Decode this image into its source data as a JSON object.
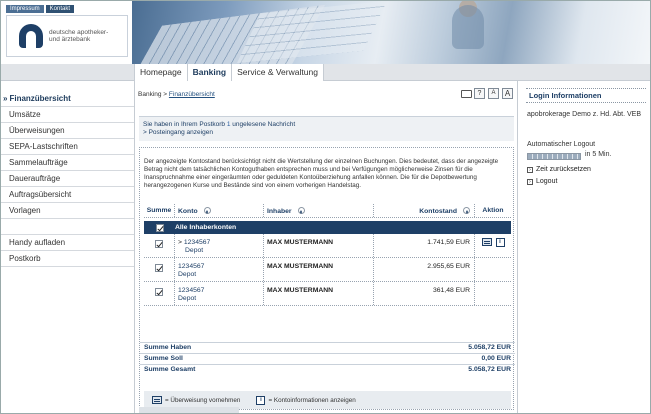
{
  "header": {
    "links": [
      "Impressum",
      "Kontakt"
    ],
    "logo_line1": "deutsche apotheker-",
    "logo_line2": "und ärztebank"
  },
  "mainnav": [
    "Homepage",
    "Banking",
    "Service & Verwaltung"
  ],
  "sidebar": {
    "items": [
      "Finanzübersicht",
      "Umsätze",
      "Überweisungen",
      "SEPA-Lastschriften",
      "Sammelaufträge",
      "Daueraufträge",
      "Auftragsübersicht",
      "Vorlagen"
    ],
    "items2": [
      "Handy aufladen",
      "Postkorb"
    ]
  },
  "breadcrumb": {
    "prefix": "Banking > ",
    "current": "Finanzübersicht"
  },
  "toolbar_icons": [
    "printer-icon",
    "help-icon",
    "font-small-icon",
    "font-large-icon"
  ],
  "toolbar_text": {
    "help": "?",
    "small": "A",
    "large": "A"
  },
  "message": {
    "prefix": "Sie haben in Ihrem Postkorb ",
    "count": "1",
    "suffix": " ungelesene Nachricht",
    "link": "> Posteingang anzeigen"
  },
  "info_text": "Der angezeigte Kontostand berücksichtigt nicht die Wertstellung der einzelnen Buchungen. Dies bedeutet, dass der angezeigte Betrag nicht dem tatsächlichen Kontoguthaben entsprechen muss und bei Verfügungen möglicherweise Zinsen für die Inanspruchnahme einer eingeräumten oder geduldeten Kontoüberziehung anfallen können. Die für die Depotbewertung herangezogenen Kurse und Bestände sind von einem vorherigen Handelstag.",
  "table": {
    "headers": [
      "Summe",
      "Konto",
      "Inhaber",
      "Kontostand",
      "Aktion"
    ],
    "group": "Alle Inhaberkonten",
    "rows": [
      {
        "konto": "1234567",
        "sub": "Depot",
        "inhaber": "MAX MUSTERMANN",
        "stand": "1.741,59 EUR"
      },
      {
        "konto": "1234567",
        "sub": "Depot",
        "inhaber": "MAX MUSTERMANN",
        "stand": "2.955,65 EUR"
      },
      {
        "konto": "1234567",
        "sub": "Depot",
        "inhaber": "MAX MUSTERMANN",
        "stand": "361,48 EUR"
      }
    ]
  },
  "sums": [
    {
      "label": "Summe Haben",
      "value": "5.058,72 EUR"
    },
    {
      "label": "Summe Soll",
      "value": "0,00 EUR"
    },
    {
      "label": "Summe Gesamt",
      "value": "5.058,72 EUR"
    }
  ],
  "legend": {
    "ueberweisung": "= Überweisung vornehmen",
    "info": "= Kontoinformationen anzeigen",
    "info_glyph": "i"
  },
  "right": {
    "title": "Login Informationen",
    "user": "apobrokerage Demo z. Hd. Abt. VEB",
    "auto": "Automatischer Logout",
    "mins": "in 5 Min.",
    "reset": "Zeit zurücksetzen",
    "logout": "Logout"
  },
  "colors": {
    "navy": "#1e3f66",
    "link": "#23507f"
  }
}
